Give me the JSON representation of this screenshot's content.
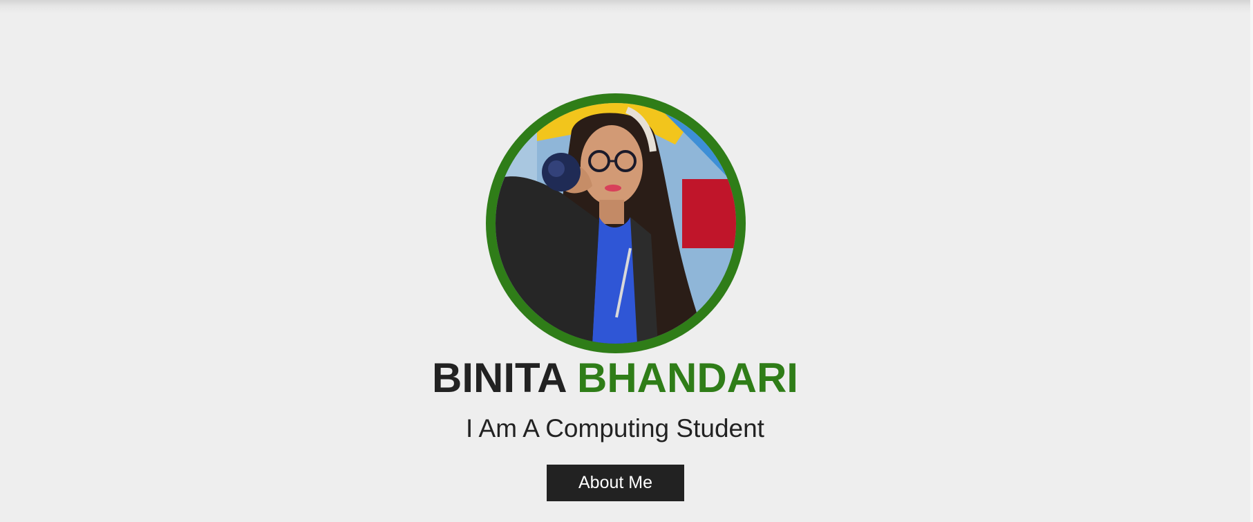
{
  "hero": {
    "first_name": "BINITA",
    "last_name": "BHANDARI",
    "tagline": "I Am A Computing Student",
    "button_label": "About Me"
  },
  "colors": {
    "accent": "#2f7d18",
    "text": "#222222",
    "background": "#eeeeee",
    "button_bg": "#222222",
    "button_text": "#ffffff"
  },
  "icons": {
    "avatar": "profile-photo"
  }
}
